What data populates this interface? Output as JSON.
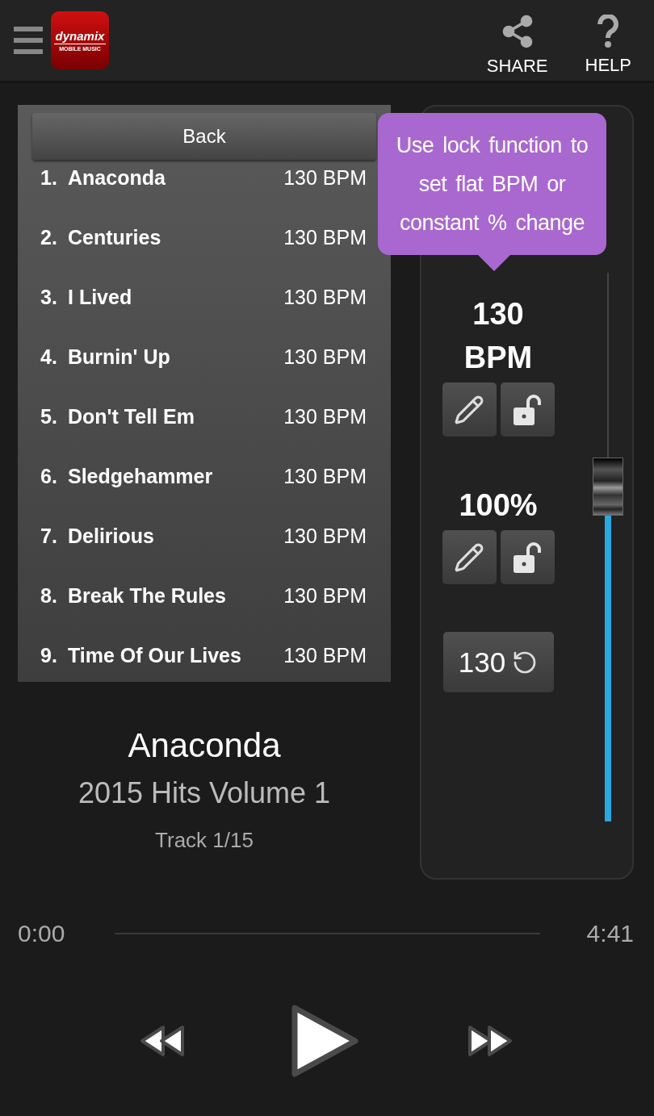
{
  "header": {
    "logo": {
      "name": "dynamix",
      "tagline": "MOBILE MUSIC"
    },
    "actions": [
      {
        "label": "SHARE",
        "kind": "share"
      },
      {
        "label": "HELP",
        "kind": "help"
      }
    ]
  },
  "playlist": {
    "back": "Back",
    "tracks": [
      {
        "number": "1.",
        "title": "Anaconda",
        "bpm": "130 BPM"
      },
      {
        "number": "2.",
        "title": "Centuries",
        "bpm": "130 BPM"
      },
      {
        "number": "3.",
        "title": "I Lived",
        "bpm": "130 BPM"
      },
      {
        "number": "4.",
        "title": "Burnin' Up",
        "bpm": "130 BPM"
      },
      {
        "number": "5.",
        "title": "Don't Tell Em",
        "bpm": "130 BPM"
      },
      {
        "number": "6.",
        "title": "Sledgehammer",
        "bpm": "130 BPM"
      },
      {
        "number": "7.",
        "title": "Delirious",
        "bpm": "130 BPM"
      },
      {
        "number": "8.",
        "title": "Break The Rules",
        "bpm": "130 BPM"
      },
      {
        "number": "9.",
        "title": "Time Of Our Lives",
        "bpm": "130 BPM"
      }
    ]
  },
  "now_playing": {
    "title": "Anaconda",
    "album": "2015 Hits Volume 1",
    "track": "Track 1/15"
  },
  "tempo": {
    "tooltip": "Use lock function to set flat BPM or constant % change",
    "bpm": {
      "value": "130",
      "unit": "BPM",
      "locked": false
    },
    "percent": {
      "value": "100%",
      "locked": false
    },
    "reset": "130",
    "slider": {
      "level": 0.61
    }
  },
  "seek": {
    "elapsed": "0:00",
    "total": "4:41"
  },
  "controls": [
    {
      "kind": "rewind"
    },
    {
      "kind": "play"
    },
    {
      "kind": "forward"
    }
  ]
}
